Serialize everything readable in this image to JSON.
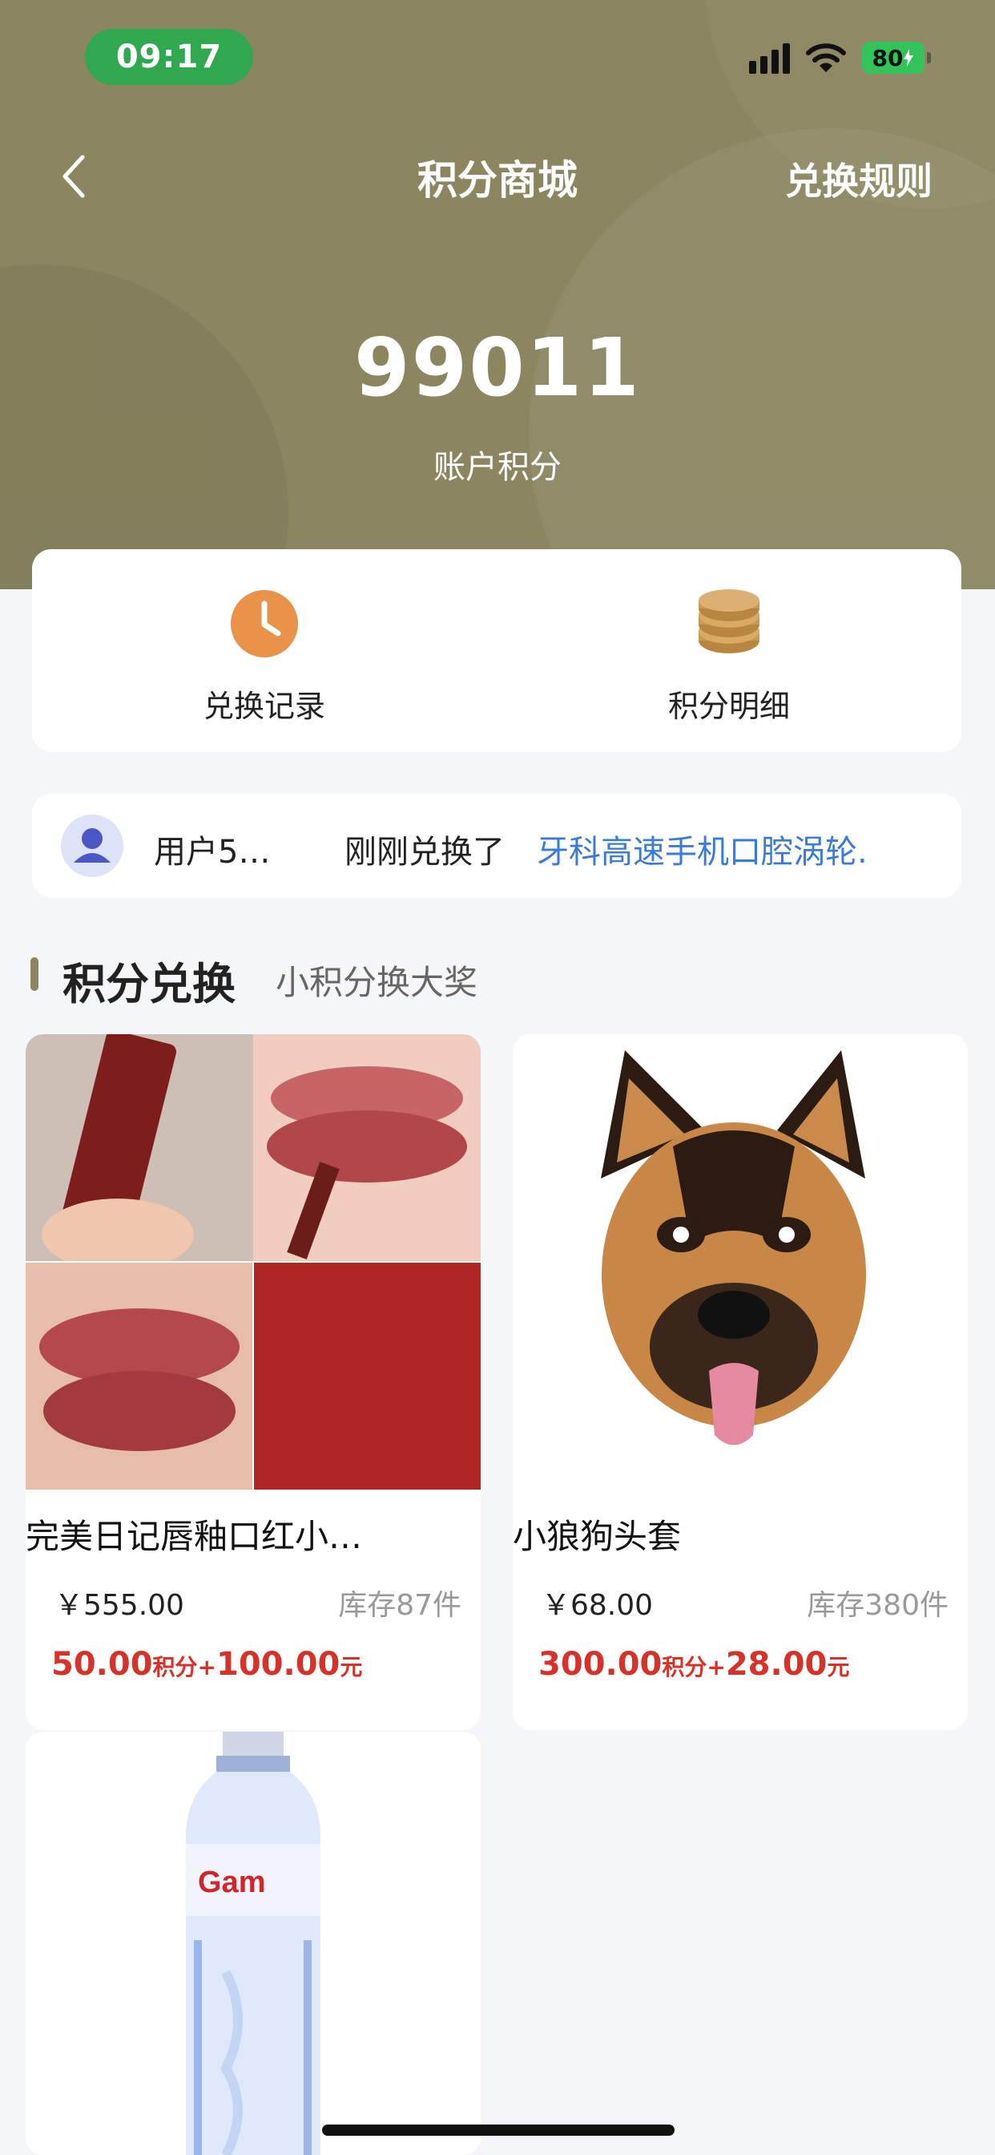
{
  "status": {
    "time": "09:17",
    "battery": "80"
  },
  "nav": {
    "title": "积分商城",
    "rules": "兑换规则"
  },
  "account": {
    "points": "99011",
    "label": "账户积分"
  },
  "actions": [
    {
      "label": "兑换记录",
      "icon": "clock-icon"
    },
    {
      "label": "积分明细",
      "icon": "coins-icon"
    }
  ],
  "notice": {
    "user": "用户5…",
    "action": "刚刚兑换了",
    "product": "牙科高速手机口腔涡轮."
  },
  "section": {
    "title": "积分兑换",
    "subtitle": "小积分换大奖"
  },
  "products": [
    {
      "name": "完美日记唇釉口红小…",
      "price": "￥555.00",
      "stock": "库存87件",
      "points": "50.00",
      "points_unit": "积分",
      "plus": "+",
      "cash": "100.00",
      "cash_unit": "元"
    },
    {
      "name": "小狼狗头套",
      "price": "￥68.00",
      "stock": "库存380件",
      "points": "300.00",
      "points_unit": "积分",
      "plus": "+",
      "cash": "28.00",
      "cash_unit": "元"
    },
    {
      "name": "",
      "price": "",
      "stock": "",
      "points": "",
      "points_unit": "",
      "plus": "",
      "cash": "",
      "cash_unit": ""
    }
  ],
  "colors": {
    "header": "#8b8560",
    "accent_blue": "#3a7bd5",
    "price_red": "#d6322a",
    "clock_orange": "#e8924a",
    "coins_tan": "#c99a55"
  }
}
